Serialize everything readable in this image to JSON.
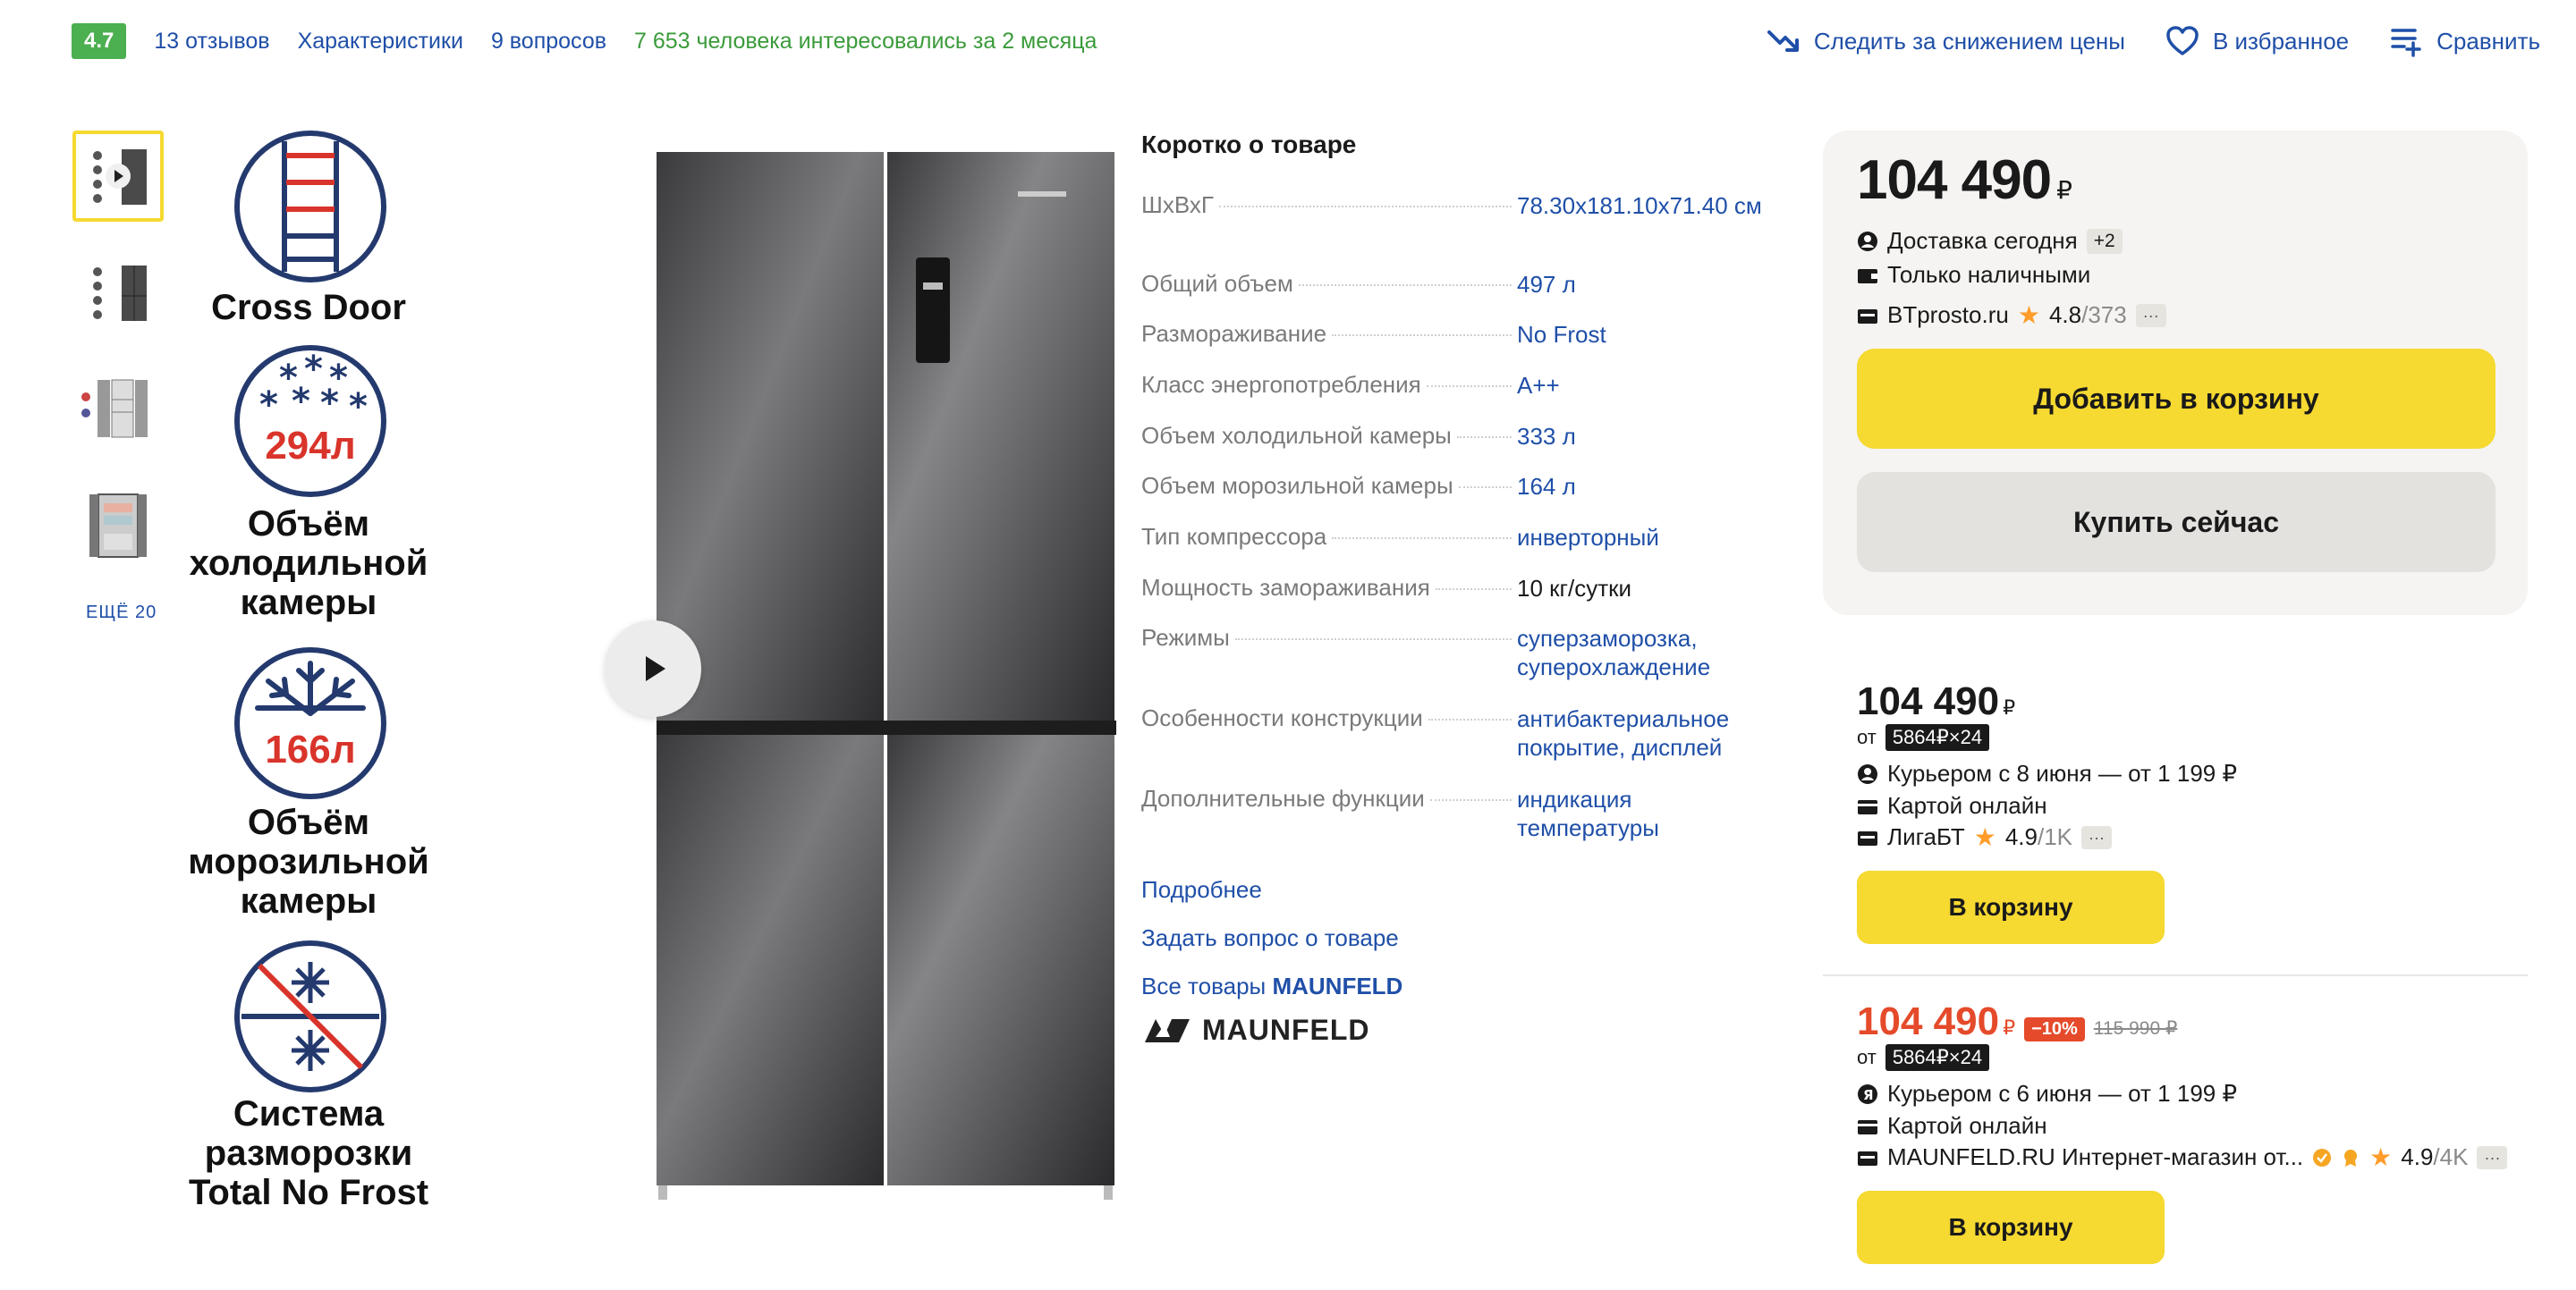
{
  "topbar": {
    "rating": "4.7",
    "reviews": "13 отзывов",
    "characteristics": "Характеристики",
    "questions": "9 вопросов",
    "interest": "7 653 человека интересовались за 2 месяца",
    "track_price": "Следить за снижением цены",
    "favorite": "В избранное",
    "compare": "Сравнить"
  },
  "gallery": {
    "more": "ЕЩЁ 20"
  },
  "features": {
    "cross_door": "Cross Door",
    "fridge_volume_value": "294л",
    "fridge_volume_label": "Объём холодильной камеры",
    "freezer_volume_value": "166л",
    "freezer_volume_label": "Объём морозильной камеры",
    "defrost_label": "Система разморозки Total No Frost"
  },
  "specs": {
    "title": "Коротко о товаре",
    "rows": [
      {
        "name": "ШхВхГ",
        "value": "78.30x181.10x71.40 см"
      },
      {
        "name": "Общий объем",
        "value": "497 л"
      },
      {
        "name": "Размораживание",
        "value": "No Frost"
      },
      {
        "name": "Класс энергопотребления",
        "value": "A++"
      },
      {
        "name": "Объем холодильной камеры",
        "value": "333 л"
      },
      {
        "name": "Объем морозильной камеры",
        "value": "164 л"
      },
      {
        "name": "Тип компрессора",
        "value": "инверторный"
      },
      {
        "name": "Мощность замораживания",
        "value": "10 кг/сутки"
      },
      {
        "name": "Режимы",
        "value": "суперзаморозка, суперохлаждение"
      },
      {
        "name": "Особенности конструкции",
        "value": "антибактериальное покрытие, дисплей"
      },
      {
        "name": "Дополнительные функции",
        "value": "индикация температуры"
      }
    ],
    "more": "Подробнее",
    "ask": "Задать вопрос о товаре",
    "all_goods_prefix": "Все товары",
    "all_goods_brand": "MAUNFELD",
    "brand_logo_text": "MAUNFELD"
  },
  "offer_main": {
    "price": "104 490",
    "currency": "₽",
    "delivery": "Доставка сегодня",
    "delivery_extra": "+2",
    "payment": "Только наличными",
    "seller": "BTprosto.ru",
    "rating": "4.8",
    "reviews": "/373",
    "more": "···",
    "add_to_cart": "Добавить в корзину",
    "buy_now": "Купить сейчас"
  },
  "offer_2": {
    "price": "104 490",
    "currency": "₽",
    "from": "от",
    "installment": "5864₽×24",
    "delivery": "Курьером с 8 июня — от 1 199 ₽",
    "payment": "Картой онлайн",
    "seller": "ЛигаБТ",
    "rating": "4.9",
    "reviews": "/1K",
    "more": "···",
    "cart": "В корзину"
  },
  "offer_3": {
    "price": "104 490",
    "currency": "₽",
    "discount": "−10%",
    "old_price": "115 990 ₽",
    "from": "от",
    "installment": "5864₽×24",
    "delivery": "Курьером с 6 июня — от 1 199 ₽",
    "payment": "Картой онлайн",
    "seller": "MAUNFELD.RU Интернет-магазин от...",
    "rating": "4.9",
    "reviews": "/4K",
    "more": "···",
    "cart": "В корзину"
  }
}
